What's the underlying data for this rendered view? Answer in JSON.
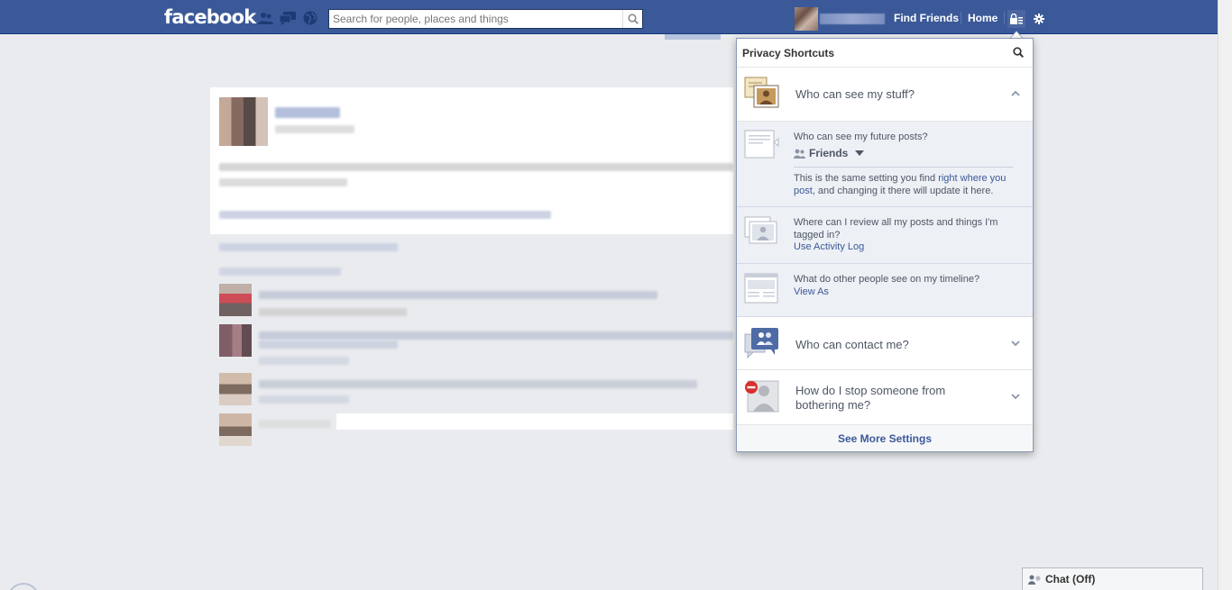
{
  "header": {
    "logo": "facebook",
    "search_placeholder": "Search for people, places and things",
    "find_friends": "Find Friends",
    "home": "Home"
  },
  "privacy": {
    "title": "Privacy Shortcuts",
    "sections": [
      {
        "label": "Who can see my stuff?",
        "state": "expanded"
      },
      {
        "label": "Who can contact me?",
        "state": "collapsed"
      },
      {
        "label": "How do I stop someone from bothering me?",
        "state": "collapsed"
      }
    ],
    "stuff": {
      "future_posts_q": "Who can see my future posts?",
      "audience": "Friends",
      "note_prefix": "This is the same setting you find ",
      "note_link": "right where you post",
      "note_suffix": ", and changing it there will update it here.",
      "review_q": "Where can I review all my posts and things I'm tagged in?",
      "review_link": "Use Activity Log",
      "timeline_q": "What do other people see on my timeline?",
      "timeline_link": "View As"
    },
    "see_more": "See More Settings"
  },
  "chat": {
    "label": "Chat (Off)"
  },
  "colors": {
    "brand": "#3b5998",
    "link": "#3b5998",
    "background": "#e9ebee",
    "expanded_bg": "#edf0f5",
    "block_red": "#d8302f"
  },
  "icons": [
    "friends-jewel-icon",
    "messages-jewel-icon",
    "notifications-jewel-icon",
    "search-icon",
    "privacy-lock-icon",
    "settings-gear-icon",
    "chevron-up-icon",
    "chevron-down-icon",
    "friends-audience-icon",
    "caret-down-icon",
    "chat-people-icon"
  ]
}
